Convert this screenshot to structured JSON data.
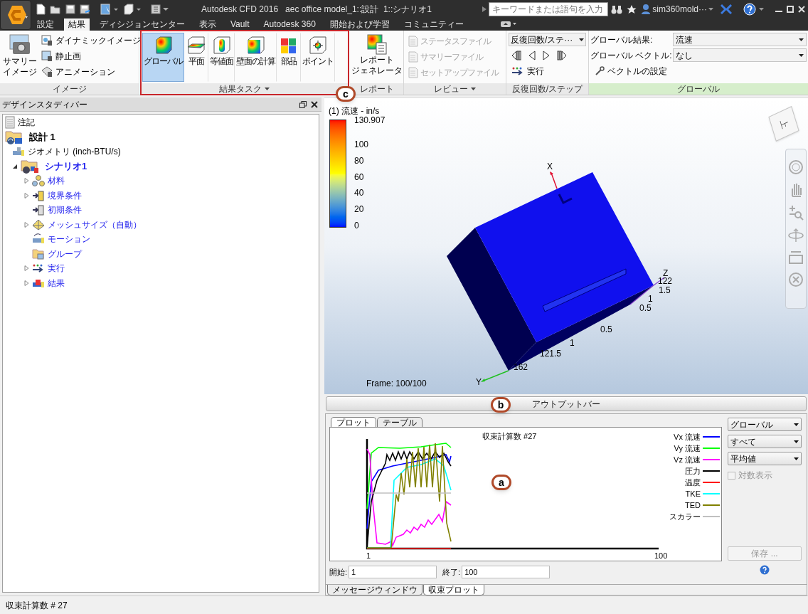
{
  "window": {
    "title": "Autodesk CFD 2016   aec office model_1::設計  1::シナリオ1",
    "search": {
      "placeholder": "キーワードまたは語句を入力"
    },
    "user": "sim360mold···"
  },
  "menu_tabs": [
    {
      "label": "設定",
      "selected": false
    },
    {
      "label": "結果",
      "selected": true
    },
    {
      "label": "ディシジョンセンター",
      "selected": false
    },
    {
      "label": "表示",
      "selected": false
    },
    {
      "label": "Vault",
      "selected": false
    },
    {
      "label": "Autodesk 360",
      "selected": false
    },
    {
      "label": "開始および学習",
      "selected": false
    },
    {
      "label": "コミュニティー",
      "selected": false
    }
  ],
  "ribbon": {
    "image": {
      "title": "イメージ",
      "large": {
        "label_lines": [
          "サマリー",
          "イメージ"
        ]
      },
      "items": [
        {
          "label": "ダイナミックイメージ",
          "kind": "dynamic"
        },
        {
          "label": "静止画",
          "kind": "still"
        },
        {
          "label": "アニメーション",
          "kind": "animation"
        }
      ]
    },
    "result_tasks": {
      "title": "結果タスク",
      "has_menu": true,
      "buttons": [
        {
          "label": "グローバル",
          "kind": "global",
          "selected": true
        },
        {
          "label": "平面",
          "kind": "plane",
          "selected": false
        },
        {
          "label": "等値面",
          "kind": "iso",
          "selected": false
        },
        {
          "label": "壁面の計算",
          "kind": "wall",
          "selected": false
        },
        {
          "label": "部品",
          "kind": "parts",
          "selected": false
        },
        {
          "label": "ポイント",
          "kind": "point",
          "selected": false
        }
      ]
    },
    "report": {
      "title": "レポート",
      "large": {
        "label_lines": [
          "レポート",
          "ジェネレータ"
        ]
      }
    },
    "review": {
      "title": "レビュー",
      "has_menu": true,
      "items": [
        {
          "label": "ステータスファイル",
          "disabled": true
        },
        {
          "label": "サマリーファイル",
          "disabled": true
        },
        {
          "label": "セットアップファイル",
          "disabled": true
        }
      ]
    },
    "iteration": {
      "title": "反復回数/ステップ",
      "dropdown": "反復回数/ステ···",
      "run": "実行"
    },
    "global": {
      "title": "グローバル",
      "rows": [
        {
          "label": "グローバル結果:",
          "value": "流速"
        },
        {
          "label": "グローバル ベクトル:",
          "value": "なし"
        }
      ],
      "button": "ベクトルの設定"
    }
  },
  "design_study_bar": {
    "title": "デザインスタディバー",
    "tree": [
      {
        "label": "注記",
        "kind": "note"
      },
      {
        "label": "設計 1",
        "kind": "design",
        "children": [
          {
            "label": "ジオメトリ (inch-BTU/s)",
            "kind": "geometry"
          },
          {
            "label": "シナリオ1",
            "kind": "scenario",
            "expanded": true,
            "children": [
              {
                "label": "材料",
                "kind": "material",
                "expanded": false
              },
              {
                "label": "境界条件",
                "kind": "boundary",
                "expanded": false
              },
              {
                "label": "初期条件",
                "kind": "initial"
              },
              {
                "label": "メッシュサイズ（自動）",
                "kind": "mesh",
                "expanded": false
              },
              {
                "label": "モーション",
                "kind": "motion"
              },
              {
                "label": "グループ",
                "kind": "group"
              },
              {
                "label": "実行",
                "kind": "run",
                "expanded": false
              },
              {
                "label": "結果",
                "kind": "results",
                "expanded": false
              }
            ]
          }
        ]
      }
    ]
  },
  "view": {
    "legend_title": "(1) 流速 - in/s",
    "legend_labels": [
      "130.907",
      "100",
      "80",
      "60",
      "40",
      "20",
      "0"
    ],
    "axes": {
      "x": "X",
      "y": "Y",
      "z": "Z"
    },
    "tick_labels": [
      "122",
      "1.5",
      "1",
      "0.5",
      "0.5",
      "1",
      "121.5",
      "162"
    ],
    "frame": "Frame: 100/100",
    "view_cube_face": "上"
  },
  "output_bar": {
    "label": "アウトプットバー",
    "tabs": [
      {
        "label": "プロット",
        "selected": true
      },
      {
        "label": "テーブル",
        "selected": false
      }
    ],
    "plot": {
      "title": "収束計算数 #27",
      "x_start": "1",
      "x_end": "100",
      "legend": [
        {
          "label": "Vx 流速",
          "color": "#0000ff"
        },
        {
          "label": "Vy 流速",
          "color": "#00ff00"
        },
        {
          "label": "Vz 流速",
          "color": "#ff00ff"
        },
        {
          "label": "圧力",
          "color": "#000000"
        },
        {
          "label": "温度",
          "color": "#ff0000"
        },
        {
          "label": "TKE",
          "color": "#00ffff"
        },
        {
          "label": "TED",
          "color": "#808000"
        },
        {
          "label": "スカラー",
          "color": "#c0c0c0"
        }
      ]
    },
    "dropdowns": [
      "グローバル",
      "すべて",
      "平均値"
    ],
    "log_scale": {
      "label": "対数表示",
      "checked": false,
      "disabled": true
    },
    "save": "保存 ...",
    "start": {
      "label": "開始:",
      "value": "1"
    },
    "end": {
      "label": "終了:",
      "value": "100"
    },
    "bottom_tabs": [
      {
        "label": "メッセージウィンドウ",
        "selected": false
      },
      {
        "label": "収束プロット",
        "selected": true
      }
    ]
  },
  "status_bar": "収束計算数 # 27",
  "callouts": [
    {
      "letter": "c"
    },
    {
      "letter": "b"
    },
    {
      "letter": "a"
    }
  ]
}
